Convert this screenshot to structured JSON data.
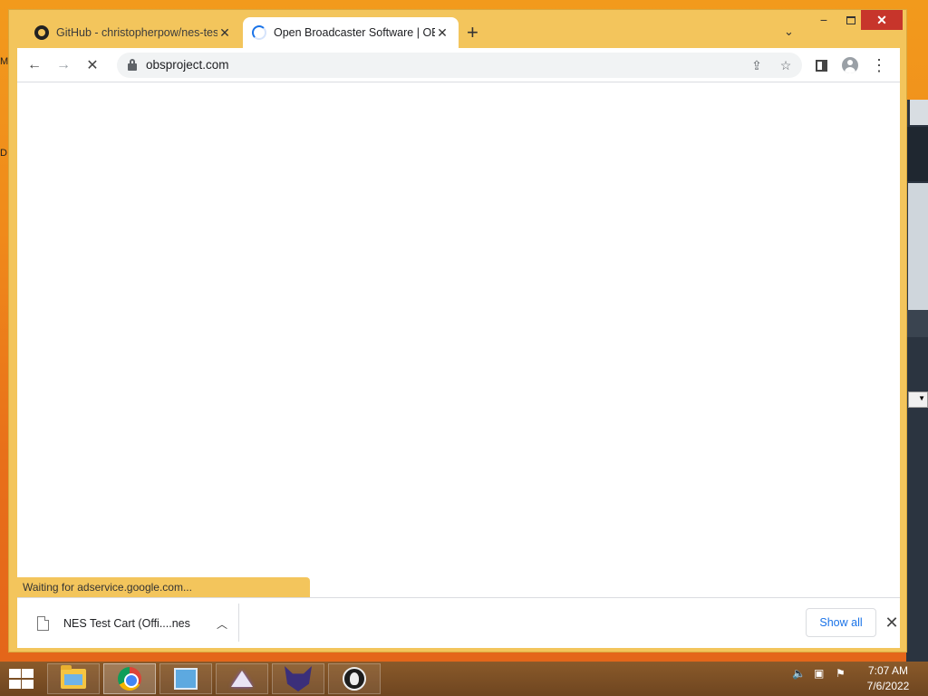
{
  "browser": {
    "tabs": [
      {
        "title": "GitHub - christopherpow/nes-tes",
        "active": false,
        "icon": "github-icon"
      },
      {
        "title": "Open Broadcaster Software | OBS",
        "active": true,
        "icon": "loading-spinner-icon"
      }
    ],
    "address_bar": {
      "url": "obsproject.com"
    },
    "status_text": "Waiting for adservice.google.com..."
  },
  "downloads": {
    "items": [
      {
        "name": "NES Test Cart (Offi....nes"
      }
    ],
    "show_all_label": "Show all"
  },
  "taskbar": {
    "apps": [
      "file-explorer-icon",
      "chrome-icon",
      "control-panel-icon",
      "app-triangle-icon",
      "app-cat-icon",
      "obs-icon"
    ],
    "clock": {
      "time": "7:07 AM",
      "date": "7/6/2022"
    }
  },
  "desktop": {
    "edge_letters": [
      "M",
      "D"
    ]
  },
  "colors": {
    "frame": "#f3c55c",
    "close": "#c7352b",
    "accent": "#1a73e8"
  }
}
